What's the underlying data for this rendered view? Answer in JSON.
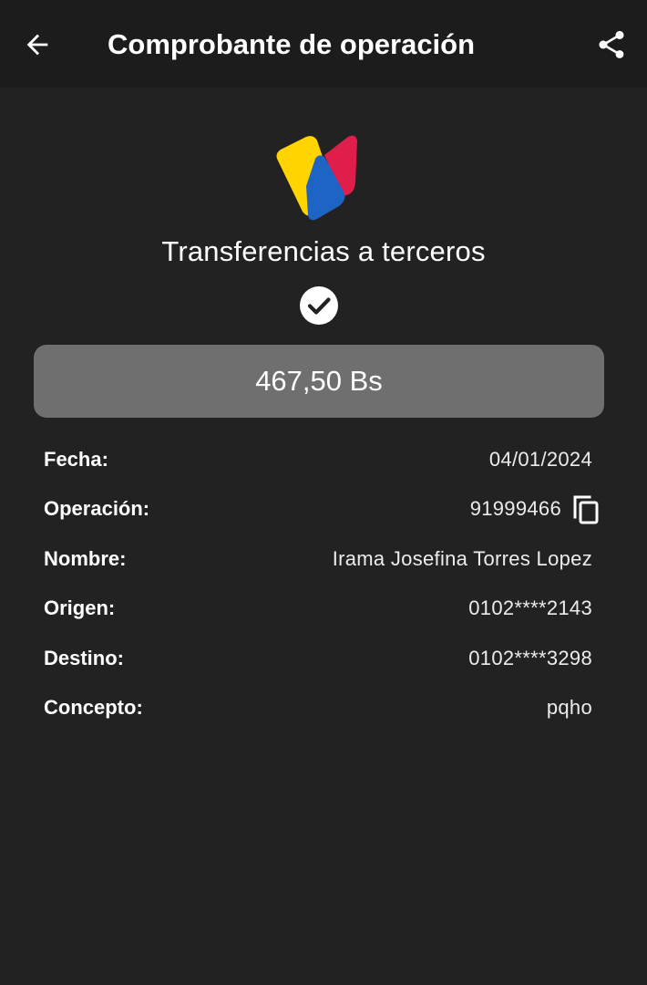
{
  "header": {
    "title": "Comprobante de operación",
    "back_icon": "arrow-left-icon",
    "share_icon": "share-icon"
  },
  "brand": {
    "logo": "bank-logo",
    "colors": {
      "yellow": "#ffd400",
      "blue": "#1d64c4",
      "red": "#e01e4b"
    }
  },
  "transaction": {
    "service": "Transferencias a terceros",
    "status_icon": "check-circle-icon",
    "amount": "467,50 Bs"
  },
  "details": [
    {
      "label": "Fecha:",
      "value": "04/01/2024"
    },
    {
      "label": "Operación:",
      "value": "91999466",
      "action_icon": "copy-icon"
    },
    {
      "label": "Nombre:",
      "value": "Irama Josefina Torres Lopez"
    },
    {
      "label": "Origen:",
      "value": "0102****2143"
    },
    {
      "label": "Destino:",
      "value": "0102****3298"
    },
    {
      "label": "Concepto:",
      "value": "pqho"
    }
  ],
  "theme": {
    "background": "#222222",
    "appbar": "#1c1c1c",
    "amount_box": "#6f6f6f",
    "text": "#ffffff"
  }
}
